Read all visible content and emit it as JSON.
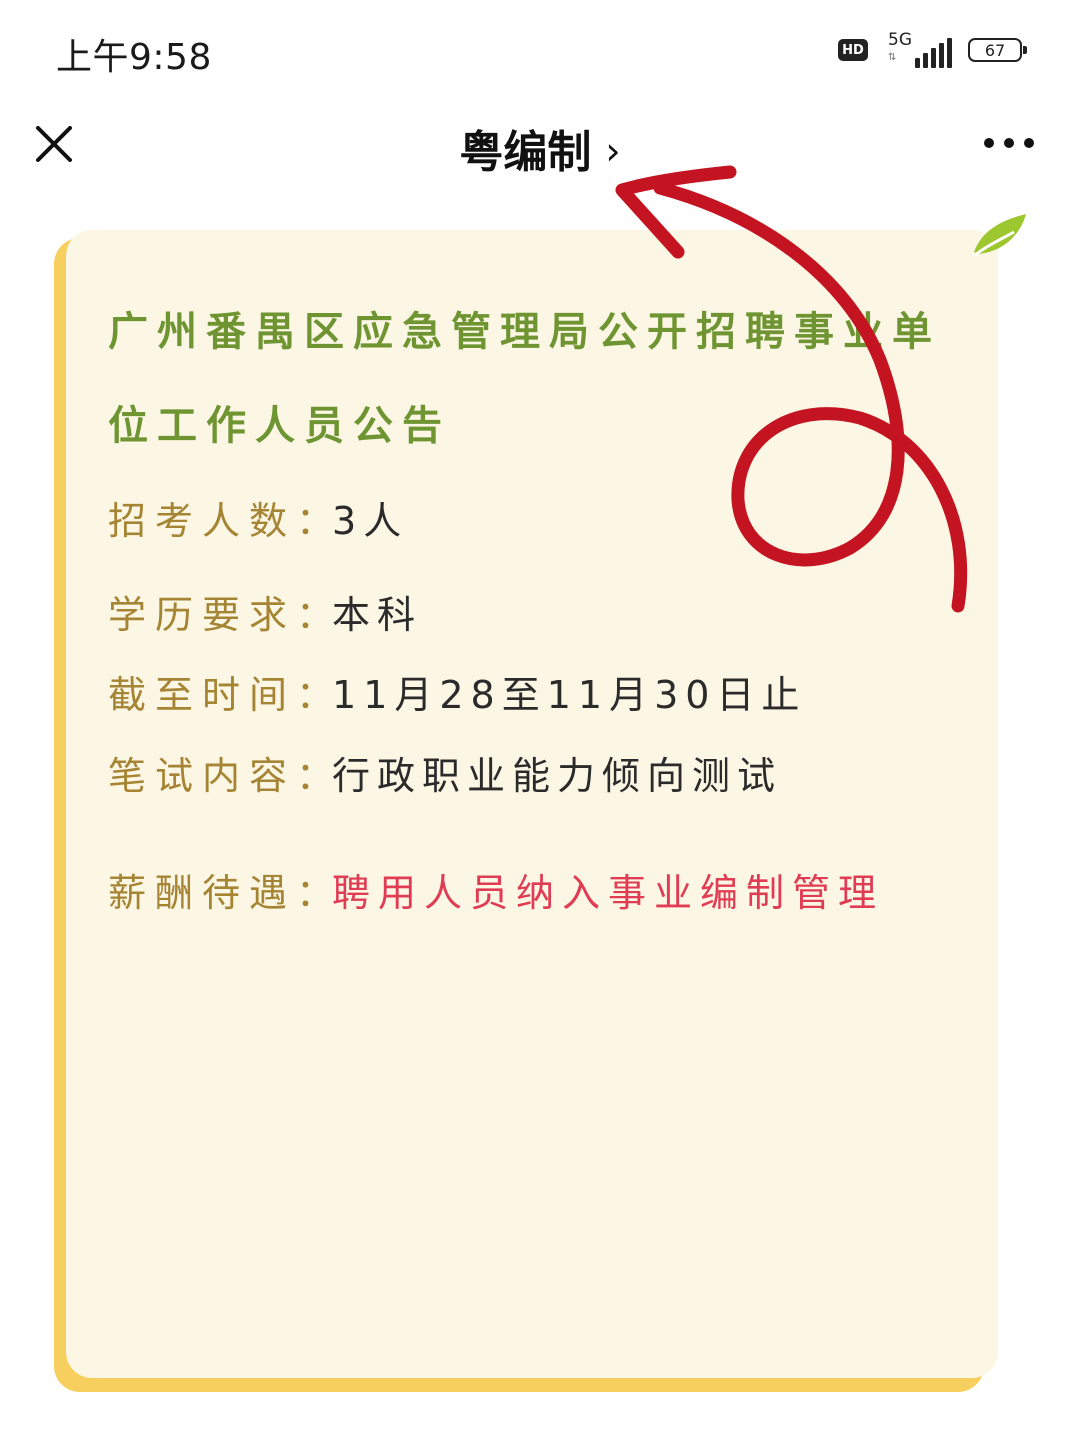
{
  "status_bar": {
    "time": "上午9:58",
    "hd_label": "HD",
    "network_label": "5G",
    "battery_level": "67"
  },
  "nav": {
    "title": "粤编制",
    "chevron": "›",
    "close_icon": "close-icon",
    "more_icon": "more-icon"
  },
  "card": {
    "title": "广州番禺区应急管理局公开招聘事业单位工作人员公告",
    "rows": [
      {
        "label": "招考人数",
        "colon": "：",
        "value": "3人"
      },
      {
        "label": "学历要求",
        "colon": "：",
        "value": "本科"
      },
      {
        "label": "截至时间",
        "colon": "：",
        "value": "11月28至11月30日止"
      },
      {
        "label": "笔试内容",
        "colon": "：",
        "value": "行政职业能力倾向测试"
      },
      {
        "label": "薪酬待遇",
        "colon": "：",
        "value": "聘用人员纳入事业编制管理"
      }
    ]
  },
  "colors": {
    "title_green": "#6f9532",
    "label_gold": "#a58533",
    "value_dark": "#2b2b2b",
    "highlight_red": "#e03d55",
    "card_bg": "#fcf6e4",
    "card_edge": "#f7cf5e",
    "annotation_red": "#c41421"
  }
}
